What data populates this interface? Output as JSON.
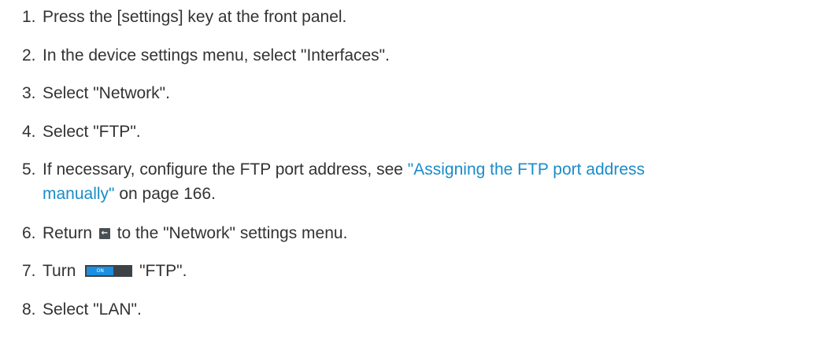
{
  "steps": [
    {
      "num": "1.",
      "text": "Press the [settings] key at the front panel."
    },
    {
      "num": "2.",
      "text": "In the device settings menu, select \"Interfaces\"."
    },
    {
      "num": "3.",
      "text": "Select \"Network\"."
    },
    {
      "num": "4.",
      "text": "Select \"FTP\"."
    },
    {
      "num": "5.",
      "before": "If necessary, configure the FTP port address, see ",
      "link_line1": "\"Assigning the FTP port address",
      "link_line2": "manually\"",
      "after": " on page 166."
    },
    {
      "num": "6.",
      "before": "Return ",
      "after": " to the \"Network\" settings menu.",
      "icon": "back-arrow-icon"
    },
    {
      "num": "7.",
      "before": "Turn ",
      "toggle_label": "ON",
      "after": " \"FTP\".",
      "icon": "toggle-switch-icon"
    },
    {
      "num": "8.",
      "text": "Select \"LAN\"."
    }
  ],
  "colors": {
    "text": "#333333",
    "link": "#1a8cc9",
    "toggle_on": "#1b8fe0",
    "toggle_track": "#3d4247",
    "icon_bg": "#4a4f55"
  }
}
